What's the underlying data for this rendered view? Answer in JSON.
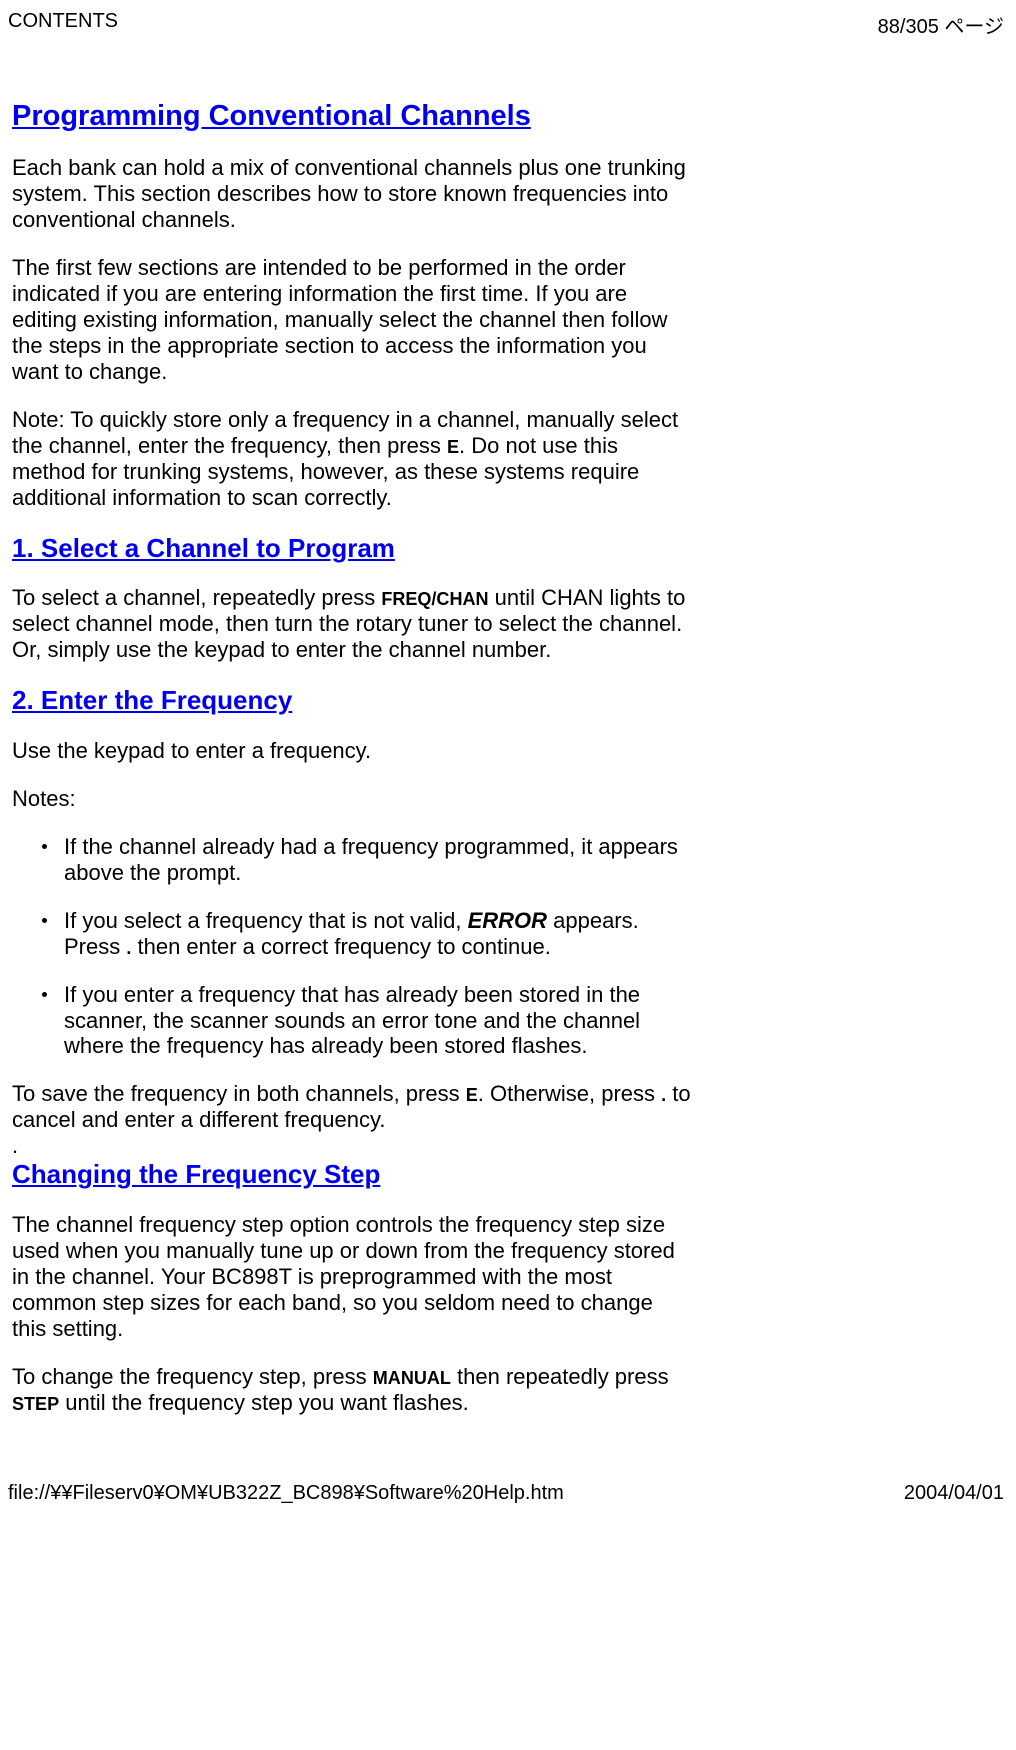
{
  "header": {
    "left": "CONTENTS",
    "right": "88/305 ページ"
  },
  "h_main": "Programming Conventional Channels",
  "p_intro1": "Each bank can hold a mix of conventional channels plus one trunking system. This section describes how to store known frequencies into conventional channels.",
  "p_intro2": "The first few sections are intended to be performed in the order indicated if you are entering information the first time. If you are editing existing information, manually select the channel then follow the steps in the appropriate section to access the information you want to change.",
  "p_note1a": "Note: To quickly store only a frequency in a channel, manually select the channel, enter the frequency, then press ",
  "kbd_E1": "E",
  "p_note1b": ". Do not use this method for trunking systems, however, as these systems require additional information to scan correctly.",
  "h_sel": "1. Select a Channel to Program",
  "p_sel_a": "To select a channel, repeatedly press ",
  "kbd_FC": "FREQ/CHAN",
  "p_sel_b": " until CHAN lights to select channel mode, then turn the rotary tuner to select the channel.  Or, simply use the keypad to enter the channel number.",
  "h_freq": "2. Enter the Frequency",
  "p_freq1": "Use the keypad to enter a frequency.",
  "p_notes": "Notes:",
  "li1": "If the channel already had a frequency programmed, it appears above the prompt.",
  "li2a": "If you select a frequency that is not valid, ",
  "li2_err": "ERROR",
  "li2b": " appears. Press ",
  "kbd_dot": ".",
  "li2c": " then enter a  correct frequency to continue.",
  "li3": "If you enter a frequency that has already been stored in the scanner, the scanner sounds an error tone and the channel where the frequency has already been stored flashes.",
  "p_save_a": "To save the frequency in both channels, press ",
  "kbd_E2": "E",
  "p_save_b": ". Otherwise, press ",
  "kbd_dot2": ".",
  "p_save_c": " to cancel and enter a different frequency.",
  "dot": ".",
  "h_step": "Changing the Frequency Step",
  "p_step1": "The channel frequency step option controls the frequency step size used when you manually tune up or down from the frequency stored in the channel. Your BC898T is preprogrammed with the most common step sizes for each band, so you seldom need to change this setting.",
  "p_step2a": "To change the frequency step, press ",
  "kbd_MAN": "MANUAL",
  "p_step2b": " then repeatedly press ",
  "kbd_STEP": "STEP",
  "p_step2c": " until the frequency step you want flashes.",
  "footer": {
    "left": "file://¥¥Fileserv0¥OM¥UB322Z_BC898¥Software%20Help.htm",
    "right": "2004/04/01"
  }
}
